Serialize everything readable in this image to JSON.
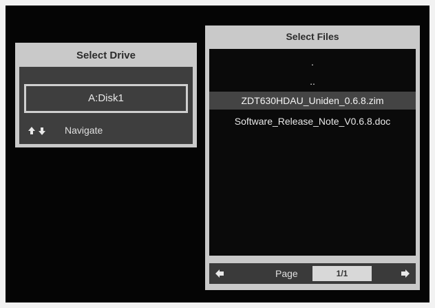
{
  "drive_panel": {
    "title": "Select Drive",
    "drive_item": "A:Disk1",
    "navigate_label": "Navigate",
    "nav_icon": "up-down-arrows-icon"
  },
  "files_panel": {
    "title": "Select Files",
    "files": [
      ".",
      "..",
      "ZDT630HDAU_Uniden_0.6.8.zim",
      "Software_Release_Note_V0.6.8.doc"
    ],
    "selected_index": 2,
    "page_label": "Page",
    "page_value": "1/1",
    "prev_icon": "arrow-left-icon",
    "next_icon": "arrow-right-icon"
  },
  "colors": {
    "panel": "#c9c9c9",
    "panel_body": "#3e3e3e",
    "screen": "#050505"
  }
}
